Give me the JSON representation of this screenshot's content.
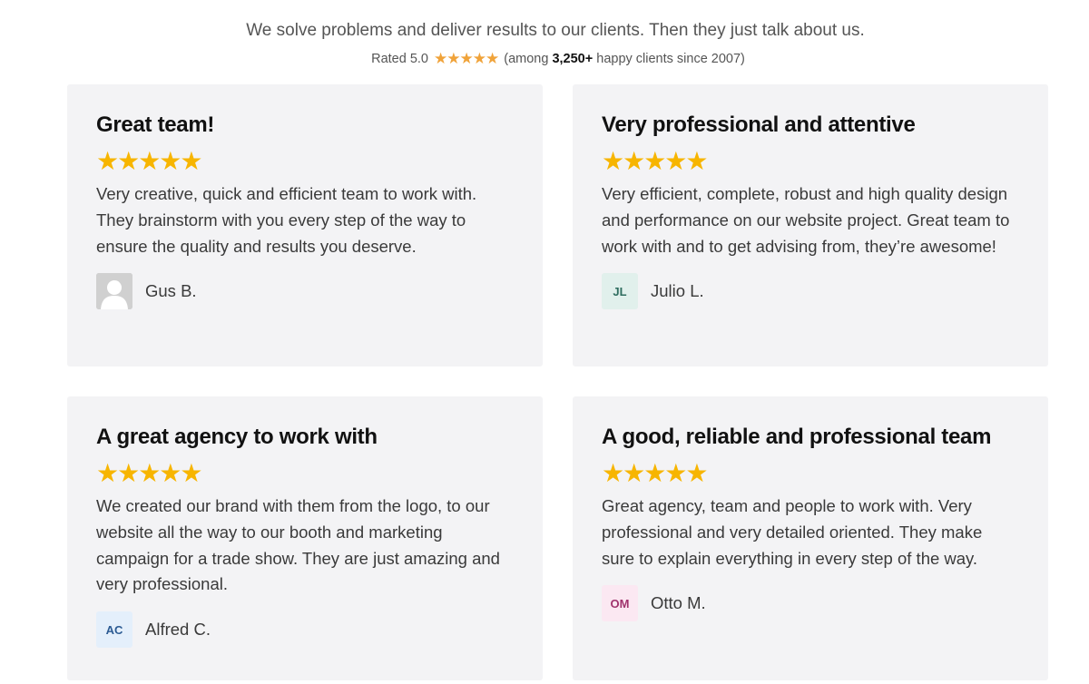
{
  "header": {
    "tagline": "We solve problems and deliver results to our clients. Then they just talk about us.",
    "rating_prefix": "Rated 5.0",
    "rating_stars": "★★★★★",
    "rating_value": 5.0,
    "rating_among": "(among",
    "rating_count": "3,250+",
    "rating_suffix": "happy clients since 2007)"
  },
  "colors": {
    "card_background": "#f3f3f5",
    "star_color": "#f7b500",
    "small_star_color": "#f0a33a"
  },
  "testimonials": [
    {
      "title": "Great team!",
      "stars": "★★★★★",
      "rating": 5,
      "quote": "Very creative, quick and efficient team to work with. They brainstorm with you every step of the way to ensure the quality and results you deserve.",
      "author": "Gus B.",
      "avatar_initials": "",
      "avatar_icon": "user-silhouette-icon"
    },
    {
      "title": "Very professional and attentive",
      "stars": "★★★★★",
      "rating": 5,
      "quote": "Very efficient, complete, robust and high quality design and performance on our website project. Great team to work with and to get advising from, they’re awesome!",
      "author": "Julio L.",
      "avatar_initials": "JL"
    },
    {
      "title": "A great agency to work with",
      "stars": "★★★★★",
      "rating": 5,
      "quote": "We created our brand with them from the logo, to our website all the way to our booth and marketing campaign for a trade show. They are just amazing and very professional.",
      "author": "Alfred C.",
      "avatar_initials": "AC"
    },
    {
      "title": "A good, reliable and professional team",
      "stars": "★★★★★",
      "rating": 5,
      "quote": "Great agency, team and people to work with. Very professional and very detailed oriented. They make sure to explain everything in every step of the way.",
      "author": "Otto M.",
      "avatar_initials": "OM"
    }
  ]
}
